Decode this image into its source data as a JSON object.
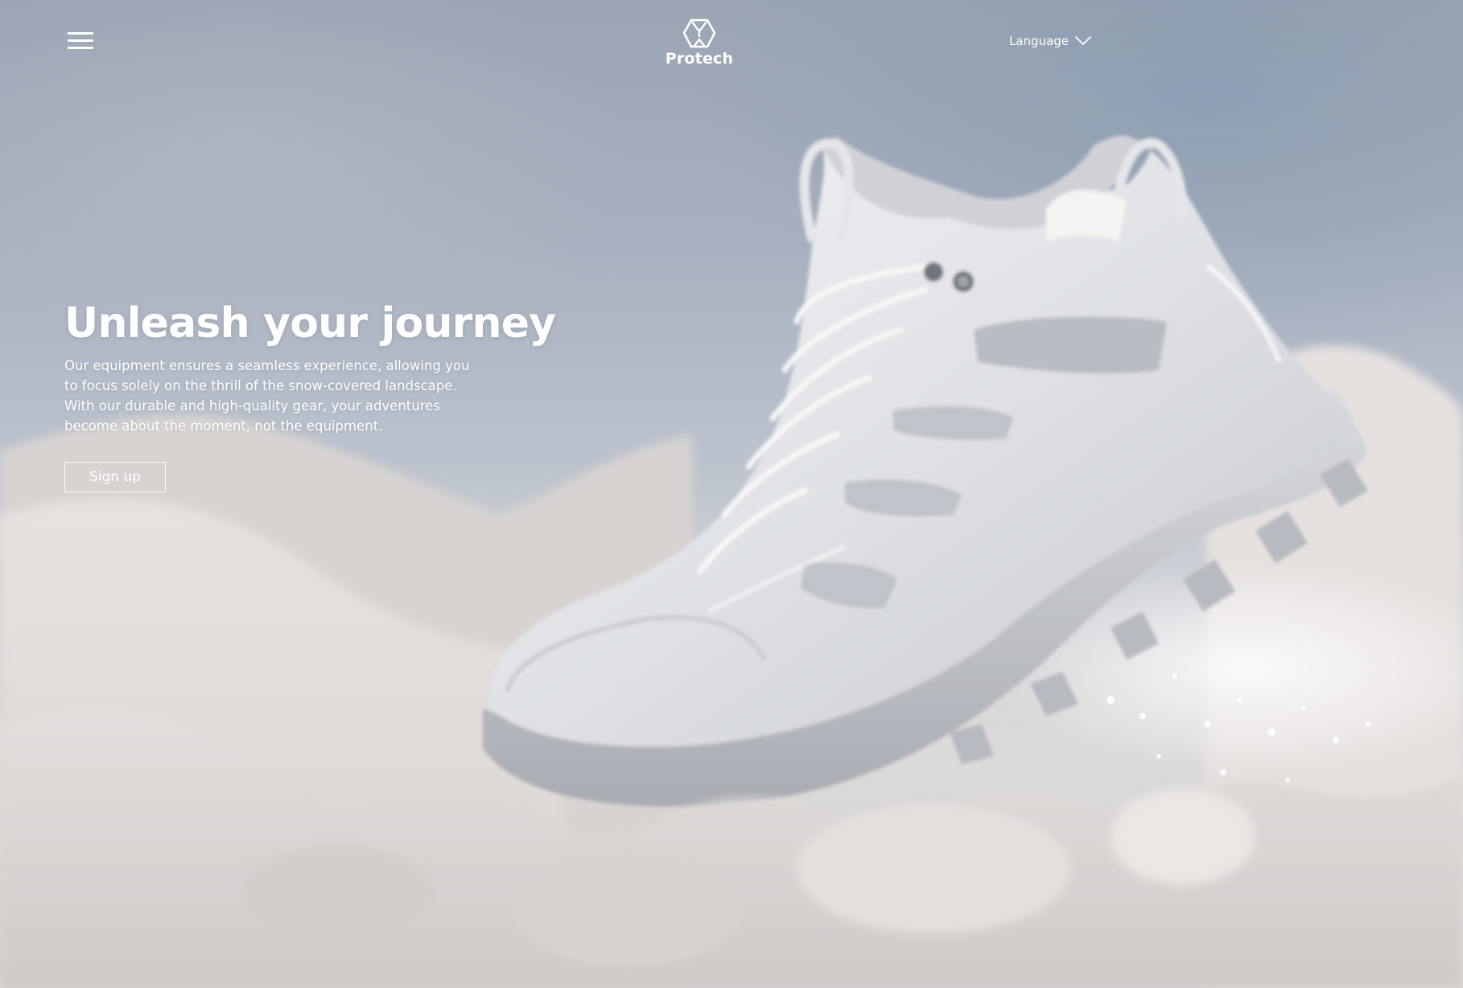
{
  "header": {
    "menu_icon": "hamburger-menu-icon",
    "brand": {
      "logo_icon": "protech-hexagon-logo-icon",
      "name": "Protech"
    },
    "language": {
      "label": "Language",
      "icon": "chevron-down-icon"
    }
  },
  "hero": {
    "title": "Unleash your journey",
    "description": "Our equipment ensures a seamless experience, allowing you to focus solely on the thrill of the snow-covered landscape. With our durable and high-quality gear, your adventures become about the moment, not the equipment.",
    "cta_label": "Sign up"
  },
  "background": {
    "image_subject": "white hiking shoe in snow",
    "colors": {
      "sky": "#9aa4b3",
      "snow": "#dcdad9",
      "text": "#ffffff"
    }
  }
}
